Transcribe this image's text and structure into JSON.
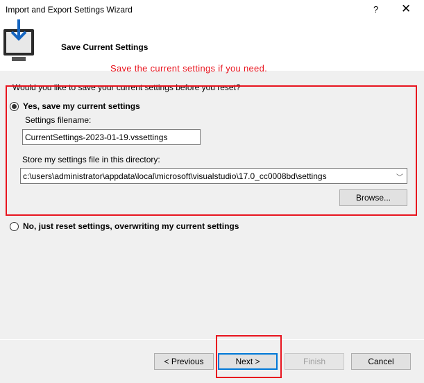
{
  "window": {
    "title": "Import and Export Settings Wizard",
    "help_label": "?",
    "close_label": "✕"
  },
  "header": {
    "icon": "monitor-download-icon",
    "title": "Save Current Settings"
  },
  "annotations": {
    "top_note": "Save the current settings if you need.",
    "highlight_color": "#e8141e"
  },
  "content": {
    "question": "Would you like to save your current settings before you reset?",
    "option_yes": {
      "label": "Yes, save my current settings",
      "selected": true
    },
    "filename_label": "Settings filename:",
    "filename_value": "CurrentSettings-2023-01-19.vssettings",
    "directory_label": "Store my settings file in this directory:",
    "directory_value": "c:\\users\\administrator\\appdata\\local\\microsoft\\visualstudio\\17.0_cc0008bd\\settings",
    "browse_label": "Browse...",
    "option_no": {
      "label": "No, just reset settings, overwriting my current settings",
      "selected": false
    }
  },
  "footer": {
    "previous_label": "< Previous",
    "next_label": "Next >",
    "finish_label": "Finish",
    "cancel_label": "Cancel",
    "finish_enabled": false,
    "focus_color": "#0078d7"
  }
}
